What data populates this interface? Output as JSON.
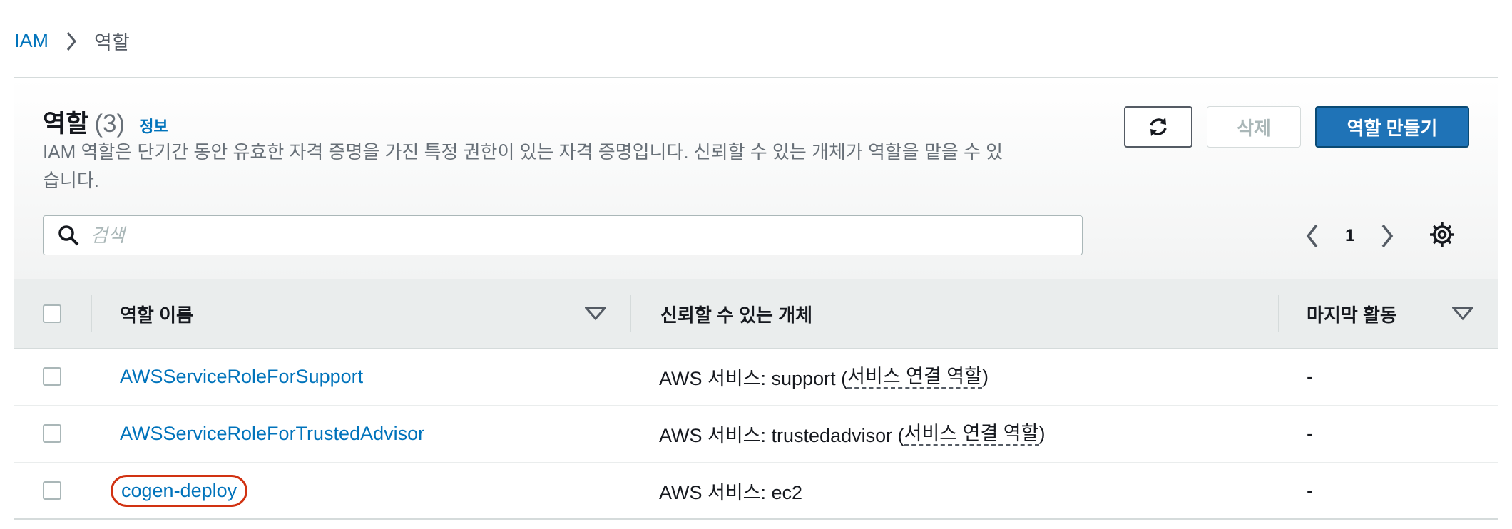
{
  "breadcrumb": {
    "root": "IAM",
    "current": "역할"
  },
  "header": {
    "title": "역할",
    "count": "(3)",
    "info_link": "정보",
    "description": "IAM 역할은 단기간 동안 유효한 자격 증명을 가진 특정 권한이 있는 자격 증명입니다. 신뢰할 수 있는 개체가 역할을 맡을 수 있습니다."
  },
  "actions": {
    "delete": "삭제",
    "create": "역할 만들기"
  },
  "search": {
    "placeholder": "검색"
  },
  "pagination": {
    "page": "1"
  },
  "table": {
    "columns": [
      "역할 이름",
      "신뢰할 수 있는 개체",
      "마지막 활동"
    ],
    "rows": [
      {
        "name": "AWSServiceRoleForSupport",
        "trusted_prefix": "AWS 서비스: support (",
        "trusted_link": "서비스 연결 역할",
        "trusted_suffix": ")",
        "last_activity": "-"
      },
      {
        "name": "AWSServiceRoleForTrustedAdvisor",
        "trusted_prefix": "AWS 서비스: trustedadvisor (",
        "trusted_link": "서비스 연결 역할",
        "trusted_suffix": ")",
        "last_activity": "-"
      },
      {
        "name": "cogen-deploy",
        "trusted_prefix": "AWS 서비스: ec2",
        "trusted_link": "",
        "trusted_suffix": "",
        "last_activity": "-"
      }
    ]
  },
  "colors": {
    "link": "#0073bb",
    "primary": "#1f73b7",
    "highlight": "#d13212"
  }
}
